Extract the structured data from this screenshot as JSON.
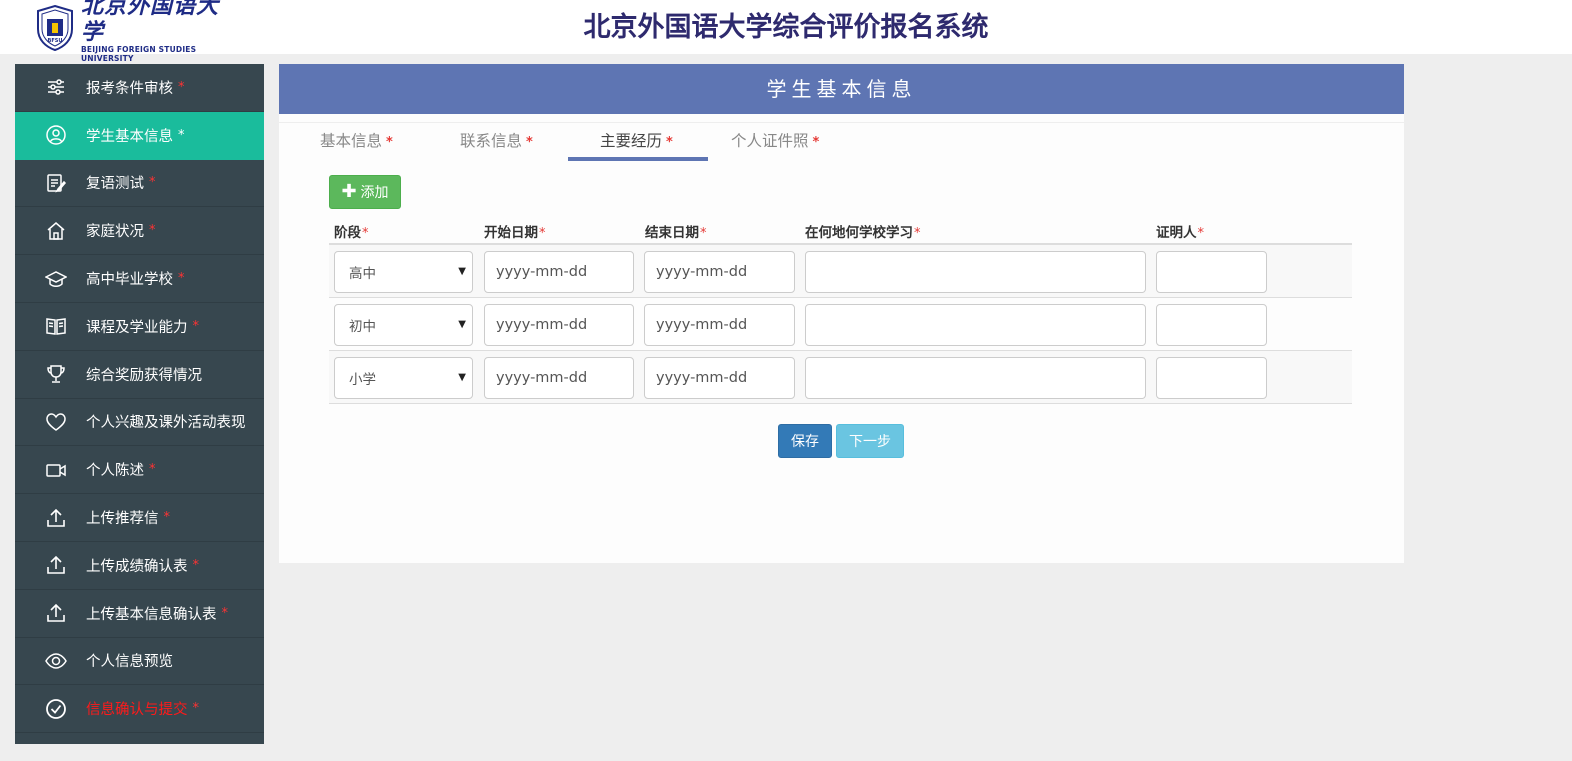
{
  "header": {
    "logo_cn": "北京外国语大学",
    "logo_en": "BEIJING FOREIGN STUDIES UNIVERSITY",
    "logo_crest": "BFSU",
    "title": "北京外国语大学综合评价报名系统"
  },
  "sidebar": {
    "items": [
      {
        "label": "报考条件审核",
        "required": "*",
        "icon": "sliders-icon"
      },
      {
        "label": "学生基本信息",
        "required": "*",
        "icon": "user-circle-icon"
      },
      {
        "label": "复语测试",
        "required": "*",
        "icon": "edit-doc-icon"
      },
      {
        "label": "家庭状况",
        "required": "*",
        "icon": "home-icon"
      },
      {
        "label": "高中毕业学校",
        "required": "*",
        "icon": "graduation-cap-icon"
      },
      {
        "label": "课程及学业能力",
        "required": "*",
        "icon": "book-icon"
      },
      {
        "label": "综合奖励获得情况",
        "required": "",
        "icon": "trophy-icon"
      },
      {
        "label": "个人兴趣及课外活动表现",
        "required": "",
        "icon": "heart-icon"
      },
      {
        "label": "个人陈述",
        "required": "*",
        "icon": "video-icon"
      },
      {
        "label": "上传推荐信",
        "required": "*",
        "icon": "upload-icon"
      },
      {
        "label": "上传成绩确认表",
        "required": "*",
        "icon": "upload-icon"
      },
      {
        "label": "上传基本信息确认表",
        "required": "*",
        "icon": "upload-icon"
      },
      {
        "label": "个人信息预览",
        "required": "",
        "icon": "eye-icon"
      },
      {
        "label": "信息确认与提交",
        "required": "*",
        "icon": "check-circle-icon"
      }
    ],
    "active_index": 1
  },
  "panel": {
    "title": "学生基本信息",
    "tabs": [
      {
        "label": "基本信息",
        "required": "*"
      },
      {
        "label": "联系信息",
        "required": "*"
      },
      {
        "label": "主要经历",
        "required": "*"
      },
      {
        "label": "个人证件照",
        "required": "*"
      }
    ],
    "active_tab": 2,
    "add_label": "添加",
    "table": {
      "headers": [
        {
          "label": "阶段",
          "required": "*"
        },
        {
          "label": "开始日期",
          "required": "*"
        },
        {
          "label": "结束日期",
          "required": "*"
        },
        {
          "label": "在何地何学校学习",
          "required": "*"
        },
        {
          "label": "证明人",
          "required": "*"
        }
      ],
      "rows": [
        {
          "stage": "高中",
          "start_placeholder": "yyyy-mm-dd",
          "end_placeholder": "yyyy-mm-dd",
          "school": "",
          "witness": ""
        },
        {
          "stage": "初中",
          "start_placeholder": "yyyy-mm-dd",
          "end_placeholder": "yyyy-mm-dd",
          "school": "",
          "witness": ""
        },
        {
          "stage": "小学",
          "start_placeholder": "yyyy-mm-dd",
          "end_placeholder": "yyyy-mm-dd",
          "school": "",
          "witness": ""
        }
      ]
    },
    "save_label": "保存",
    "next_label": "下一步"
  },
  "colors": {
    "sidebar_bg": "#37474f",
    "active": "#1abc9c",
    "panel_head": "#5e75b3",
    "add_btn": "#5cb85c",
    "save_btn": "#337ab7",
    "next_btn": "#5bc0de",
    "warn": "#ff1a1a"
  }
}
